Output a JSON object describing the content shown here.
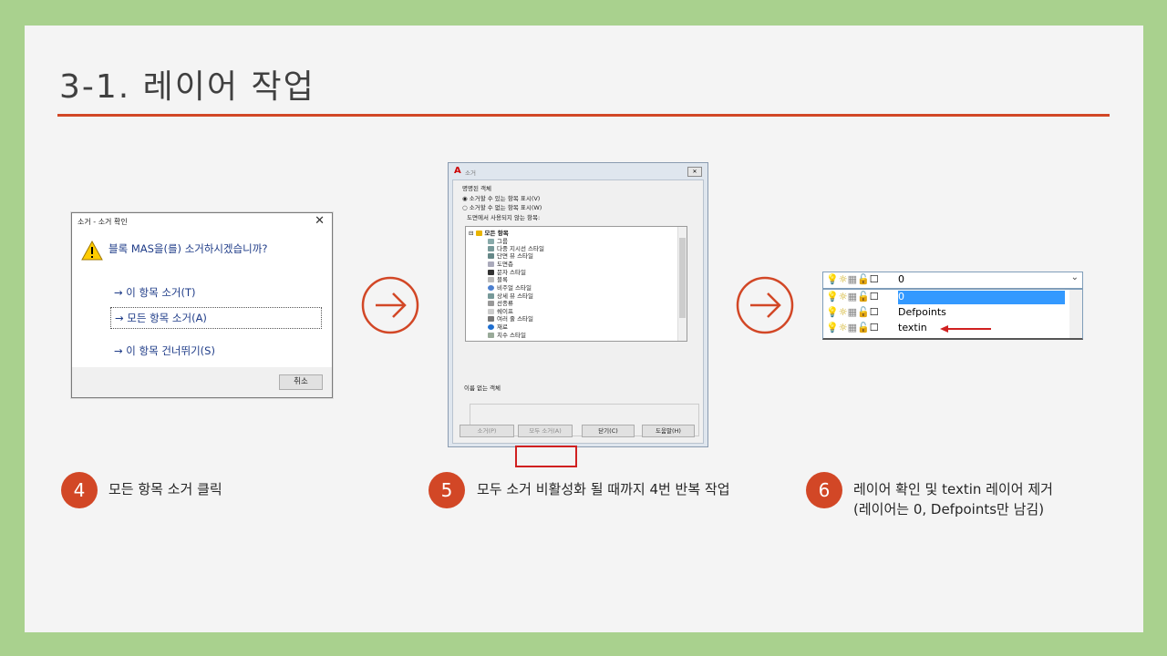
{
  "slide": {
    "title": "3-1. 레이어 작업"
  },
  "dialog1": {
    "caption": "소거 - 소거 확인",
    "question": "블록 MAS을(를) 소거하시겠습니까?",
    "options": [
      "→ 이 항목 소거(T)",
      "→ 모든 항목 소거(A)",
      "→ 이 항목 건너뛰기(S)"
    ],
    "cancel": "취소"
  },
  "dialog2": {
    "title": "소거",
    "named_objects": "명명된 객체",
    "radio1": "소거할 수 있는 항목 표시(V)",
    "radio2": "소거할 수 없는 항목 표시(W)",
    "unused_label": "도면에서 사용되지 않는 항목:",
    "tree": [
      "모든 항목",
      "그룹",
      "다중 지시선 스타일",
      "단면 뷰 스타일",
      "도면층",
      "문자 스타일",
      "블록",
      "비주얼 스타일",
      "상세 뷰 스타일",
      "선종류",
      "쉐이프",
      "여러 줄 스타일",
      "재료",
      "치수 스타일"
    ],
    "unnamed_objects": "이름 없는 객체",
    "buttons": [
      "소거(P)",
      "모두 소거(A)",
      "닫기(C)",
      "도움말(H)"
    ]
  },
  "layer_dropdown": {
    "current": "0",
    "layers": [
      "0",
      "Defpoints",
      "textin"
    ]
  },
  "steps": [
    {
      "number": "4",
      "text": "모든 항목 소거 클릭"
    },
    {
      "number": "5",
      "text": "모두 소거 비활성화 될 때까지 4번 반복 작업"
    },
    {
      "number": "6",
      "text_line1": "레이어 확인 및 textin 레이어 제거",
      "text_line2": "(레이어는 0, Defpoints만 남김)"
    }
  ],
  "colors": {
    "accent": "#d24726",
    "frame": "#a9d18e",
    "link": "#1f3c88"
  }
}
